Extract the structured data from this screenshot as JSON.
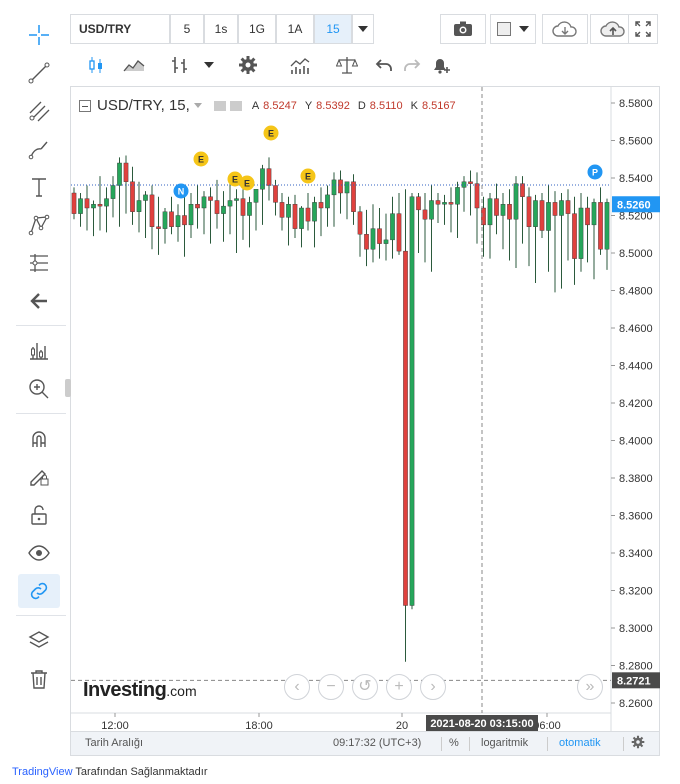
{
  "header": {
    "symbol": "USD/TRY",
    "intervals": [
      "5",
      "1s",
      "1G",
      "1A",
      "15"
    ],
    "active_interval": "15"
  },
  "legend": {
    "symbol_interval": "USD/TRY, 15,",
    "a_label": "A",
    "a_value": "8.5247",
    "y_label": "Y",
    "y_value": "8.5392",
    "d_label": "D",
    "d_value": "8.5110",
    "k_label": "K",
    "k_value": "8.5167"
  },
  "price_axis": {
    "ticks": [
      "8.5800",
      "8.5600",
      "8.5400",
      "8.5200",
      "8.5000",
      "8.4800",
      "8.4600",
      "8.4400",
      "8.4200",
      "8.4000",
      "8.3800",
      "8.3600",
      "8.3400",
      "8.3200",
      "8.3000",
      "8.2800",
      "8.2600"
    ],
    "last_price_label": "8.5260",
    "crosshair_price_label": "8.2721"
  },
  "time_axis": {
    "ticks": [
      "12:00",
      "18:00",
      "20",
      "06:00"
    ],
    "crosshair_time_label": "2021-08-20 03:15:00"
  },
  "events": {
    "e_label": "E",
    "n_label": "N",
    "p_label": "P"
  },
  "watermark": {
    "brand": "Investing",
    "suffix": ".com"
  },
  "bottom_bar": {
    "range_label": "Tarih Aralığı",
    "clock": "09:17:32 (UTC+3)",
    "percent": "%",
    "log": "logaritmik",
    "auto": "otomatik"
  },
  "footer": {
    "brand": "TradingView",
    "text": " Tarafından Sağlanmaktadır"
  },
  "colors": {
    "up": "#26a65b",
    "down": "#e0413e",
    "wick": "#2b5a3c",
    "accent": "#2196f3",
    "event": "#f5c518",
    "news": "#2196f3"
  },
  "chart_data": {
    "type": "candlestick",
    "symbol": "USD/TRY",
    "interval": "15",
    "ylim": [
      8.255,
      8.585
    ],
    "candles": [
      {
        "o": 8.532,
        "h": 8.535,
        "l": 8.518,
        "c": 8.521
      },
      {
        "o": 8.521,
        "h": 8.532,
        "l": 8.514,
        "c": 8.529
      },
      {
        "o": 8.529,
        "h": 8.536,
        "l": 8.512,
        "c": 8.524
      },
      {
        "o": 8.524,
        "h": 8.528,
        "l": 8.509,
        "c": 8.526
      },
      {
        "o": 8.526,
        "h": 8.541,
        "l": 8.512,
        "c": 8.525
      },
      {
        "o": 8.525,
        "h": 8.535,
        "l": 8.511,
        "c": 8.529
      },
      {
        "o": 8.529,
        "h": 8.541,
        "l": 8.519,
        "c": 8.536
      },
      {
        "o": 8.536,
        "h": 8.551,
        "l": 8.514,
        "c": 8.548
      },
      {
        "o": 8.548,
        "h": 8.552,
        "l": 8.521,
        "c": 8.538
      },
      {
        "o": 8.538,
        "h": 8.546,
        "l": 8.515,
        "c": 8.522
      },
      {
        "o": 8.522,
        "h": 8.538,
        "l": 8.511,
        "c": 8.528
      },
      {
        "o": 8.528,
        "h": 8.533,
        "l": 8.508,
        "c": 8.531
      },
      {
        "o": 8.531,
        "h": 8.536,
        "l": 8.502,
        "c": 8.514
      },
      {
        "o": 8.514,
        "h": 8.53,
        "l": 8.499,
        "c": 8.513
      },
      {
        "o": 8.513,
        "h": 8.524,
        "l": 8.505,
        "c": 8.522
      },
      {
        "o": 8.522,
        "h": 8.53,
        "l": 8.51,
        "c": 8.514
      },
      {
        "o": 8.514,
        "h": 8.526,
        "l": 8.506,
        "c": 8.52
      },
      {
        "o": 8.52,
        "h": 8.53,
        "l": 8.498,
        "c": 8.515
      },
      {
        "o": 8.515,
        "h": 8.532,
        "l": 8.508,
        "c": 8.526
      },
      {
        "o": 8.526,
        "h": 8.536,
        "l": 8.513,
        "c": 8.524
      },
      {
        "o": 8.524,
        "h": 8.533,
        "l": 8.51,
        "c": 8.53
      },
      {
        "o": 8.53,
        "h": 8.535,
        "l": 8.505,
        "c": 8.528
      },
      {
        "o": 8.528,
        "h": 8.539,
        "l": 8.513,
        "c": 8.521
      },
      {
        "o": 8.521,
        "h": 8.533,
        "l": 8.506,
        "c": 8.525
      },
      {
        "o": 8.525,
        "h": 8.537,
        "l": 8.51,
        "c": 8.528
      },
      {
        "o": 8.528,
        "h": 8.534,
        "l": 8.5,
        "c": 8.529
      },
      {
        "o": 8.529,
        "h": 8.534,
        "l": 8.507,
        "c": 8.52
      },
      {
        "o": 8.52,
        "h": 8.53,
        "l": 8.503,
        "c": 8.527
      },
      {
        "o": 8.527,
        "h": 8.532,
        "l": 8.512,
        "c": 8.534
      },
      {
        "o": 8.534,
        "h": 8.547,
        "l": 8.515,
        "c": 8.545
      },
      {
        "o": 8.545,
        "h": 8.551,
        "l": 8.528,
        "c": 8.536
      },
      {
        "o": 8.536,
        "h": 8.539,
        "l": 8.52,
        "c": 8.527
      },
      {
        "o": 8.527,
        "h": 8.532,
        "l": 8.512,
        "c": 8.519
      },
      {
        "o": 8.519,
        "h": 8.53,
        "l": 8.504,
        "c": 8.526
      },
      {
        "o": 8.526,
        "h": 8.531,
        "l": 8.508,
        "c": 8.513
      },
      {
        "o": 8.513,
        "h": 8.525,
        "l": 8.503,
        "c": 8.524
      },
      {
        "o": 8.524,
        "h": 8.532,
        "l": 8.512,
        "c": 8.517
      },
      {
        "o": 8.517,
        "h": 8.53,
        "l": 8.503,
        "c": 8.527
      },
      {
        "o": 8.527,
        "h": 8.535,
        "l": 8.509,
        "c": 8.524
      },
      {
        "o": 8.524,
        "h": 8.536,
        "l": 8.514,
        "c": 8.531
      },
      {
        "o": 8.531,
        "h": 8.543,
        "l": 8.514,
        "c": 8.539
      },
      {
        "o": 8.539,
        "h": 8.544,
        "l": 8.521,
        "c": 8.532
      },
      {
        "o": 8.532,
        "h": 8.537,
        "l": 8.518,
        "c": 8.538
      },
      {
        "o": 8.538,
        "h": 8.542,
        "l": 8.515,
        "c": 8.522
      },
      {
        "o": 8.522,
        "h": 8.525,
        "l": 8.498,
        "c": 8.51
      },
      {
        "o": 8.51,
        "h": 8.523,
        "l": 8.493,
        "c": 8.502
      },
      {
        "o": 8.502,
        "h": 8.526,
        "l": 8.495,
        "c": 8.513
      },
      {
        "o": 8.513,
        "h": 8.524,
        "l": 8.497,
        "c": 8.505
      },
      {
        "o": 8.505,
        "h": 8.521,
        "l": 8.496,
        "c": 8.507
      },
      {
        "o": 8.507,
        "h": 8.53,
        "l": 8.497,
        "c": 8.521
      },
      {
        "o": 8.521,
        "h": 8.532,
        "l": 8.499,
        "c": 8.501
      },
      {
        "o": 8.501,
        "h": 8.534,
        "l": 8.282,
        "c": 8.312
      },
      {
        "o": 8.312,
        "h": 8.532,
        "l": 8.31,
        "c": 8.53
      },
      {
        "o": 8.53,
        "h": 8.532,
        "l": 8.5,
        "c": 8.523
      },
      {
        "o": 8.523,
        "h": 8.532,
        "l": 8.495,
        "c": 8.518
      },
      {
        "o": 8.518,
        "h": 8.536,
        "l": 8.49,
        "c": 8.528
      },
      {
        "o": 8.528,
        "h": 8.532,
        "l": 8.516,
        "c": 8.526
      },
      {
        "o": 8.526,
        "h": 8.531,
        "l": 8.515,
        "c": 8.527
      },
      {
        "o": 8.527,
        "h": 8.535,
        "l": 8.511,
        "c": 8.526
      },
      {
        "o": 8.526,
        "h": 8.538,
        "l": 8.508,
        "c": 8.535
      },
      {
        "o": 8.535,
        "h": 8.541,
        "l": 8.522,
        "c": 8.538
      },
      {
        "o": 8.538,
        "h": 8.544,
        "l": 8.52,
        "c": 8.537
      },
      {
        "o": 8.537,
        "h": 8.543,
        "l": 8.505,
        "c": 8.524
      },
      {
        "o": 8.524,
        "h": 8.53,
        "l": 8.498,
        "c": 8.515
      },
      {
        "o": 8.515,
        "h": 8.532,
        "l": 8.497,
        "c": 8.529
      },
      {
        "o": 8.529,
        "h": 8.537,
        "l": 8.51,
        "c": 8.52
      },
      {
        "o": 8.52,
        "h": 8.532,
        "l": 8.502,
        "c": 8.526
      },
      {
        "o": 8.526,
        "h": 8.534,
        "l": 8.496,
        "c": 8.518
      },
      {
        "o": 8.518,
        "h": 8.541,
        "l": 8.492,
        "c": 8.537
      },
      {
        "o": 8.537,
        "h": 8.541,
        "l": 8.505,
        "c": 8.53
      },
      {
        "o": 8.53,
        "h": 8.535,
        "l": 8.493,
        "c": 8.514
      },
      {
        "o": 8.514,
        "h": 8.531,
        "l": 8.484,
        "c": 8.528
      },
      {
        "o": 8.528,
        "h": 8.532,
        "l": 8.508,
        "c": 8.512
      },
      {
        "o": 8.512,
        "h": 8.536,
        "l": 8.49,
        "c": 8.527
      },
      {
        "o": 8.527,
        "h": 8.533,
        "l": 8.479,
        "c": 8.52
      },
      {
        "o": 8.52,
        "h": 8.532,
        "l": 8.481,
        "c": 8.528
      },
      {
        "o": 8.528,
        "h": 8.534,
        "l": 8.496,
        "c": 8.521
      },
      {
        "o": 8.521,
        "h": 8.53,
        "l": 8.483,
        "c": 8.497
      },
      {
        "o": 8.497,
        "h": 8.532,
        "l": 8.49,
        "c": 8.524
      },
      {
        "o": 8.524,
        "h": 8.53,
        "l": 8.495,
        "c": 8.515
      },
      {
        "o": 8.515,
        "h": 8.529,
        "l": 8.486,
        "c": 8.527
      },
      {
        "o": 8.527,
        "h": 8.535,
        "l": 8.499,
        "c": 8.502
      },
      {
        "o": 8.502,
        "h": 8.529,
        "l": 8.491,
        "c": 8.527
      }
    ]
  }
}
